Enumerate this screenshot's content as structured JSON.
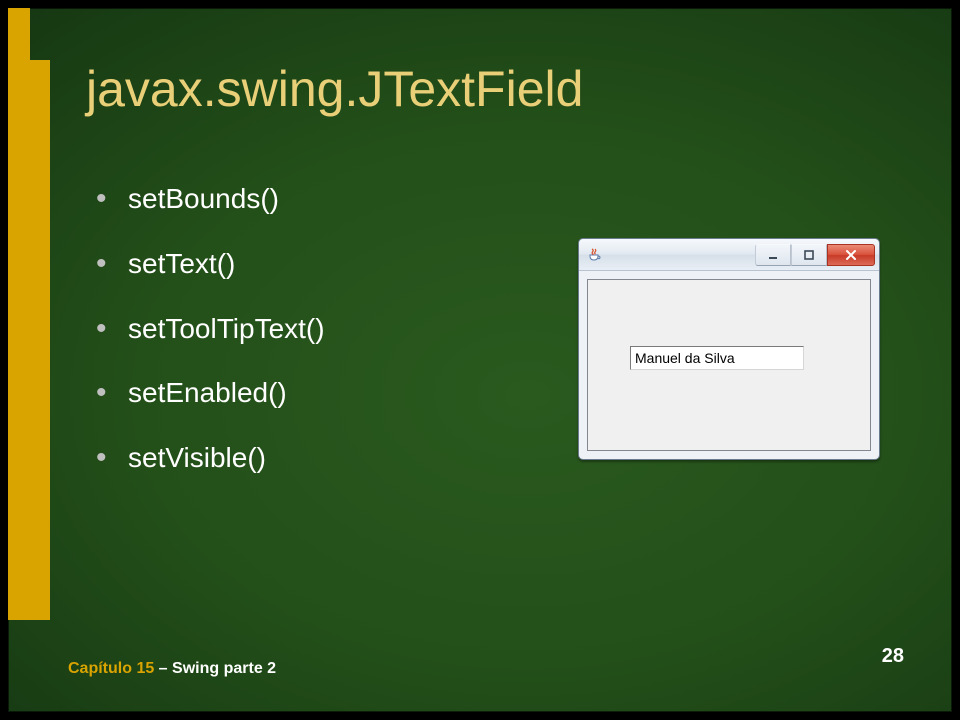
{
  "title": "javax.swing.JTextField",
  "bullets": [
    "setBounds()",
    "setText()",
    "setToolTipText()",
    "setEnabled()",
    "setVisible()"
  ],
  "window": {
    "textfield_value": "Manuel da Silva"
  },
  "footer": {
    "chapter": "Capítulo 15",
    "separator": " – ",
    "rest": "Swing parte 2"
  },
  "page_number": "28"
}
